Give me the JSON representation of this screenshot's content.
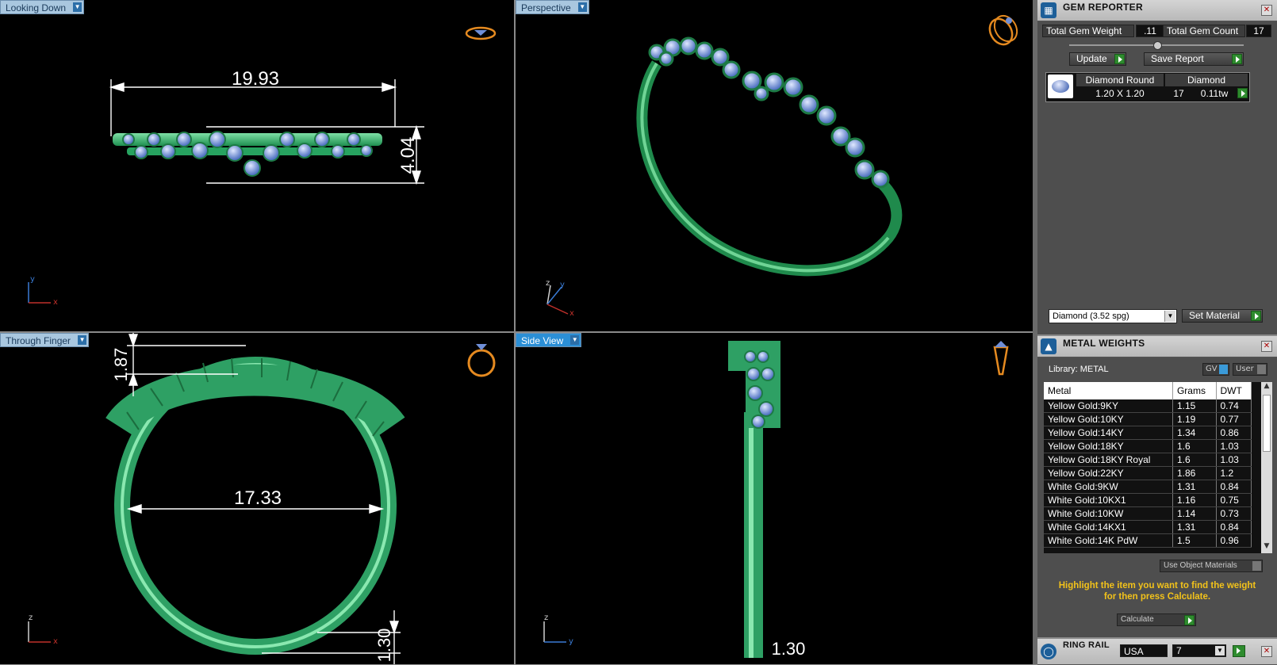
{
  "viewports": {
    "top_left": {
      "label": "Looking Down",
      "dims": [
        "19.93",
        "4.04"
      ]
    },
    "top_right": {
      "label": "Perspective"
    },
    "bottom_left": {
      "label": "Through Finger",
      "dims": [
        "1.87",
        "17.33",
        "1.30"
      ]
    },
    "bottom_right": {
      "label": "Side View",
      "dims": [
        "1.30"
      ]
    },
    "axis": {
      "x": "x",
      "y": "y",
      "z": "z"
    }
  },
  "gem_reporter": {
    "title": "GEM REPORTER",
    "total_weight_label": "Total Gem Weight",
    "total_weight_value": ".11",
    "total_count_label": "Total Gem Count",
    "total_count_value": "17",
    "update_label": "Update",
    "save_report_label": "Save Report",
    "gem_row": {
      "shape": "Diamond Round",
      "type": "Diamond",
      "size": "1.20 X 1.20",
      "count": "17",
      "weight": "0.11tw"
    },
    "material_select": "Diamond   (3.52 spg)",
    "set_material_label": "Set Material"
  },
  "metal_weights": {
    "title": "METAL WEIGHTS",
    "library_label": "Library: METAL",
    "gv_label": "GV",
    "user_label": "User",
    "columns": [
      "Metal",
      "Grams",
      "DWT"
    ],
    "rows": [
      [
        "Yellow Gold:9KY",
        "1.15",
        "0.74"
      ],
      [
        "Yellow Gold:10KY",
        "1.19",
        "0.77"
      ],
      [
        "Yellow Gold:14KY",
        "1.34",
        "0.86"
      ],
      [
        "Yellow Gold:18KY",
        "1.6",
        "1.03"
      ],
      [
        "Yellow Gold:18KY Royal",
        "1.6",
        "1.03"
      ],
      [
        "Yellow Gold:22KY",
        "1.86",
        "1.2"
      ],
      [
        "White Gold:9KW",
        "1.31",
        "0.84"
      ],
      [
        "White Gold:10KX1",
        "1.16",
        "0.75"
      ],
      [
        "White Gold:10KW",
        "1.14",
        "0.73"
      ],
      [
        "White Gold:14KX1",
        "1.31",
        "0.84"
      ],
      [
        "White Gold:14K PdW",
        "1.5",
        "0.96"
      ]
    ],
    "use_object_materials": "Use Object Materials",
    "hint": "Highlight the item you want to find the weight for then press Calculate.",
    "calculate_label": "Calculate"
  },
  "ring_rail": {
    "title": "RING RAIL",
    "country": "USA",
    "size": "7"
  }
}
